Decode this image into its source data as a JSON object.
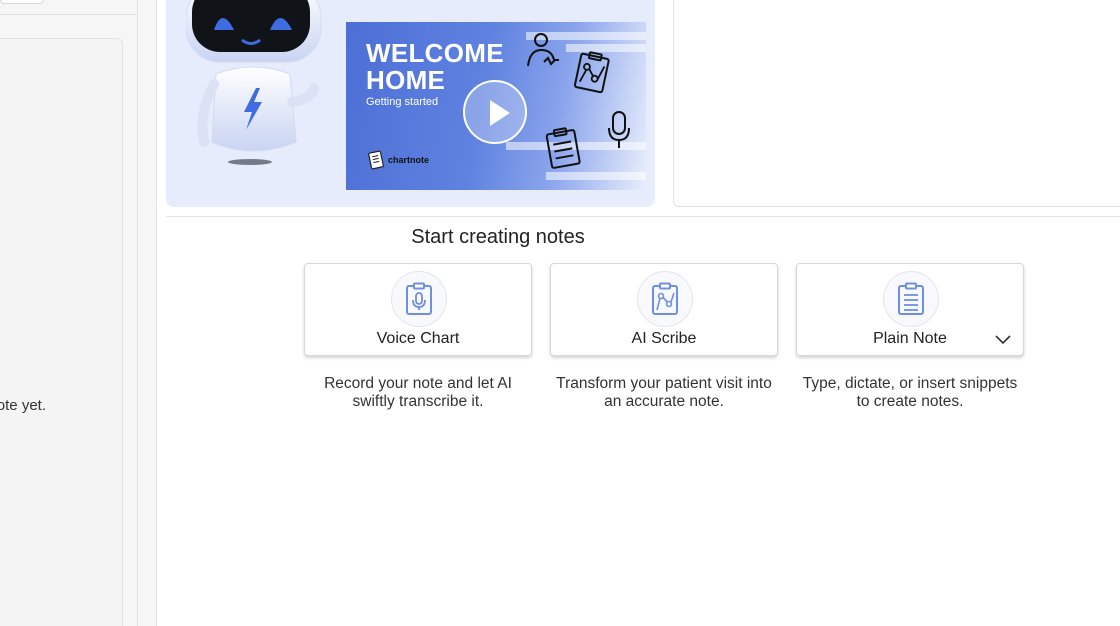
{
  "left_panel": {
    "empty_message": "No note yet."
  },
  "banner": {
    "video_title": "WELCOME\nHOME",
    "video_subtitle": "Getting started",
    "brand_text_a": "chart",
    "brand_text_b": "note",
    "accent_color": "#4d6fd6"
  },
  "main": {
    "section_title": "Start creating notes",
    "tiles": [
      {
        "label": "Voice Chart",
        "icon": "clipboard-mic-icon",
        "description": "Record your note and let AI swiftly transcribe it."
      },
      {
        "label": "AI Scribe",
        "icon": "clipboard-chart-icon",
        "description": "Transform your patient visit into an accurate note."
      },
      {
        "label": "Plain Note",
        "icon": "clipboard-lines-icon",
        "description": "Type, dictate, or insert snippets to create notes.",
        "has_dropdown": true
      }
    ]
  }
}
